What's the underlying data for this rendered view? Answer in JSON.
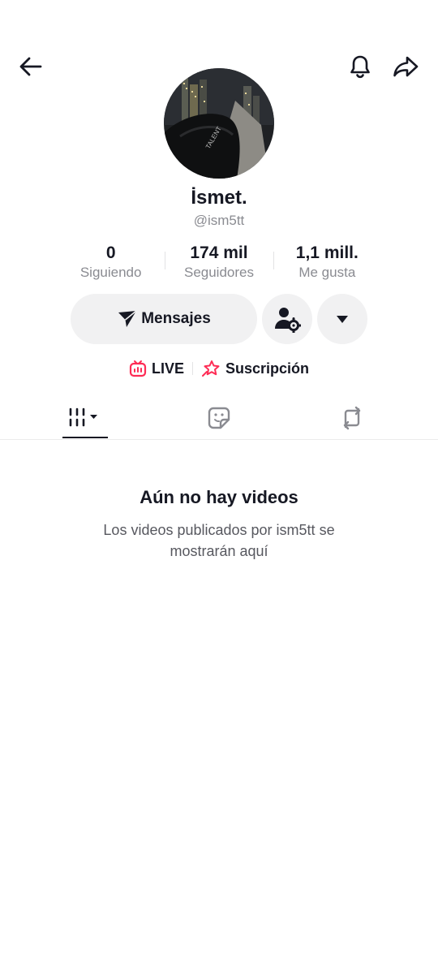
{
  "profile": {
    "display_name": "İsmet.",
    "handle": "@ism5tt"
  },
  "stats": [
    {
      "value": "0",
      "label": "Siguiendo"
    },
    {
      "value": "174 mil",
      "label": "Seguidores"
    },
    {
      "value": "1,1 mill.",
      "label": "Me gusta"
    }
  ],
  "actions": {
    "message_label": "Mensajes"
  },
  "links": {
    "live_label": "LIVE",
    "subscription_label": "Suscripción"
  },
  "tabs": [
    {
      "name": "videos",
      "icon": "grid-icon",
      "active": true
    },
    {
      "name": "favorites",
      "icon": "sticker-icon",
      "active": false
    },
    {
      "name": "reposts",
      "icon": "repost-icon",
      "active": false
    }
  ],
  "empty_state": {
    "title": "Aún no hay videos",
    "description": "Los videos publicados por ism5tt se mostrarán aquí"
  },
  "colors": {
    "text": "#161823",
    "secondary_text": "#8a8b91",
    "button_bg": "#f1f1f2",
    "accent_pink": "#fe2c55"
  }
}
